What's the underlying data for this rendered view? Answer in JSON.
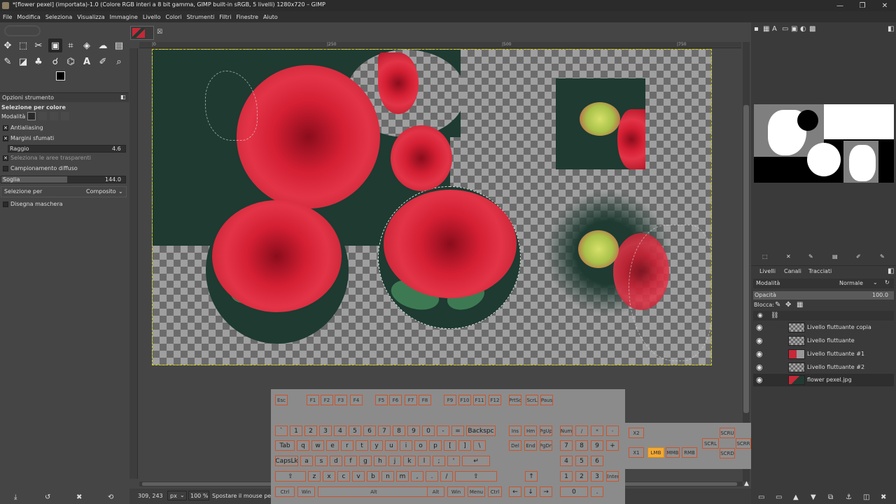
{
  "window": {
    "title": "*[flower pexel] (importata)-1.0 (Colore RGB interi a 8 bit gamma, GIMP built-in sRGB, 5 livelli) 1280x720 – GIMP",
    "min": "—",
    "max": "❐",
    "close": "✕"
  },
  "menu": [
    "File",
    "Modifica",
    "Seleziona",
    "Visualizza",
    "Immagine",
    "Livello",
    "Colori",
    "Strumenti",
    "Filtri",
    "Finestre",
    "Aiuto"
  ],
  "tool_options": {
    "tab_label": "Opzioni strumento",
    "tool_name": "Selezione per colore",
    "mode_label": "Modalità",
    "antialiasing": "Antialiasing",
    "feather": "Margini sfumati",
    "radius_label": "Raggio",
    "radius_value": "4.6",
    "select_transparent": "Seleziona le aree trasparenti",
    "sample_merged": "Campionamento diffuso",
    "threshold_label": "Soglia",
    "threshold_value": "144.0",
    "select_by_label": "Selezione per",
    "select_by_value": "Composito",
    "draw_mask": "Disegna maschera"
  },
  "ruler_ticks": [
    "|0",
    "|250",
    "|500",
    "|750",
    "|1000",
    "|1250"
  ],
  "status": {
    "coords": "309, 243",
    "unit": "px",
    "zoom": "100 %",
    "message": "Spostare il mouse pe"
  },
  "layers_panel": {
    "tabs": [
      "Livelli",
      "Canali",
      "Tracciati"
    ],
    "mode_label": "Modalità",
    "mode_value": "Normale",
    "opacity_label": "Opacità",
    "opacity_value": "100.0",
    "lock_label": "Blocca:",
    "layers": [
      {
        "name": "Livello fluttuante copia"
      },
      {
        "name": "Livello fluttuante"
      },
      {
        "name": "Livello fluttuante #1"
      },
      {
        "name": "Livello fluttuante #2"
      },
      {
        "name": "flower pexel.jpg"
      }
    ]
  },
  "keyboard": {
    "frow": [
      "Esc",
      "F1",
      "F2",
      "F3",
      "F4",
      "F5",
      "F6",
      "F7",
      "F8",
      "F9",
      "F10",
      "F11",
      "F12",
      "PrtSc",
      "ScrL",
      "Paus"
    ],
    "row1": [
      "`",
      "1",
      "2",
      "3",
      "4",
      "5",
      "6",
      "7",
      "8",
      "9",
      "0",
      "-",
      "=",
      "Backspc"
    ],
    "row2": [
      "Tab",
      "q",
      "w",
      "e",
      "r",
      "t",
      "y",
      "u",
      "i",
      "o",
      "p",
      "[",
      "]",
      "\\"
    ],
    "row3": [
      "CapsLk",
      "a",
      "s",
      "d",
      "f",
      "g",
      "h",
      "j",
      "k",
      "l",
      ";",
      "'",
      "↵"
    ],
    "row4": [
      "⇧",
      "z",
      "x",
      "c",
      "v",
      "b",
      "n",
      "m",
      ",",
      ".",
      "/",
      "⇧"
    ],
    "row5": [
      "Ctrl",
      "Win",
      "Alt",
      "Alt",
      "Win",
      "Menu",
      "Ctrl"
    ],
    "nav1": [
      "Ins",
      "Hm",
      "PgUp"
    ],
    "nav2": [
      "Del",
      "End",
      "PgDn"
    ],
    "arrows": [
      "↑",
      "←",
      "↓",
      "→"
    ],
    "num1": [
      "Num",
      "/",
      "*",
      "-"
    ],
    "num2": [
      "7",
      "8",
      "9",
      "+"
    ],
    "num3": [
      "4",
      "5",
      "6"
    ],
    "num4": [
      "1",
      "2",
      "3",
      "Enter"
    ],
    "num5": [
      "0",
      "."
    ]
  },
  "mouse": {
    "x2": "X2",
    "x1": "X1",
    "lmb": "LMB",
    "mmb": "MMB",
    "rmb": "RMB",
    "scrl": "SCRL",
    "scru": "SCRU",
    "scrd": "SCRD",
    "scrr": "SCRR"
  },
  "colors": {
    "accent_selection": "#d8d200",
    "flower_red": "#d51f33",
    "bg_green": "#1e3a31",
    "lmb_highlight": "#f2a936"
  }
}
